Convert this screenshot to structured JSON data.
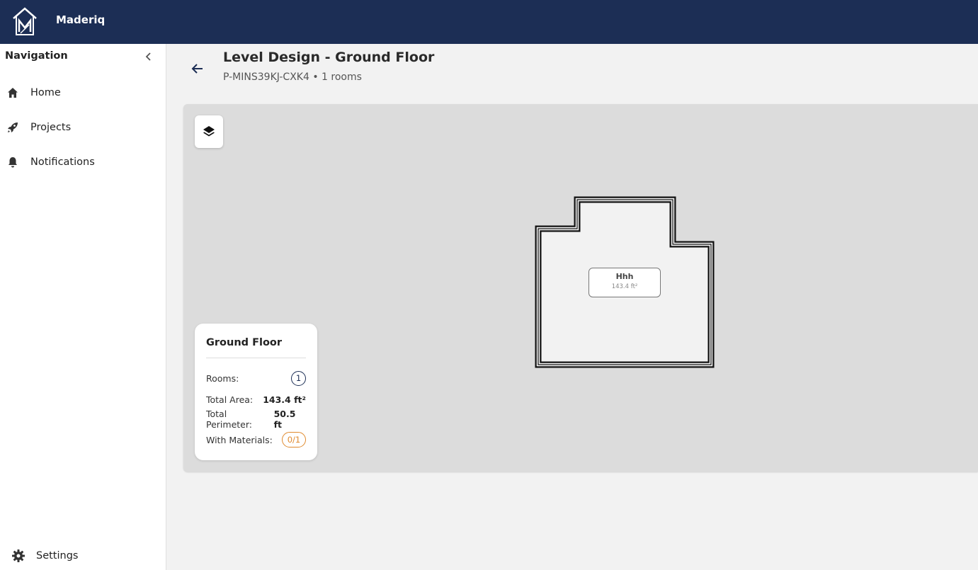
{
  "app": {
    "name": "Maderiq",
    "logo_icon": "house-logo-icon"
  },
  "sidebar": {
    "title": "Navigation",
    "items": [
      {
        "label": "Home",
        "icon": "home-icon"
      },
      {
        "label": "Projects",
        "icon": "rocket-icon"
      },
      {
        "label": "Notifications",
        "icon": "bell-icon"
      }
    ],
    "settings_label": "Settings"
  },
  "header": {
    "title": "Level Design - Ground Floor",
    "subtitle": "P-MINS39KJ-CXK4 • 1 rooms"
  },
  "canvas": {
    "background": "#dcdcdc",
    "room": {
      "name": "Hhh",
      "area": "143.4 ft²"
    }
  },
  "summary": {
    "title": "Ground Floor",
    "rooms_label": "Rooms:",
    "rooms_value": "1",
    "area_label": "Total Area:",
    "area_value": "143.4 ft²",
    "perimeter_label": "Total Perimeter:",
    "perimeter_value": "50.5 ft",
    "materials_label": "With Materials:",
    "materials_value": "0/1"
  },
  "colors": {
    "topbar": "#1c2e55",
    "accent": "#1c2e55",
    "materials_badge": "#e08a2e"
  }
}
